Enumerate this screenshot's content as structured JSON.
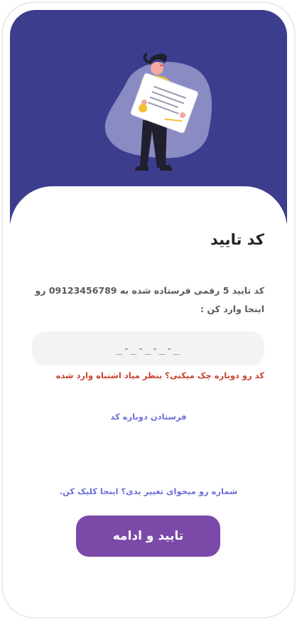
{
  "screen": {
    "title": "کد تایید",
    "description": "کد تایید 5 رقمی فرستاده شده به 09123456789 رو اینجا وارد کن :"
  },
  "code_input": {
    "placeholder": "_-_-_-_-_",
    "value": ""
  },
  "error_message": "کد رو دوباره چک میکنی؟ بنظر میاد اشتباه وارد شده",
  "links": {
    "resend_code": "فرستادن دوباره کد",
    "change_number": "شماره رو میخوای تغییر بدی؟ اینجا کلیک کن."
  },
  "buttons": {
    "submit_label": "تایید و ادامه"
  },
  "colors": {
    "hero_background": "#3d3d8e",
    "primary_button": "#7b4aa8",
    "link": "#6b6fd6",
    "error": "#c9402a"
  },
  "illustration": {
    "icon": "woman-holding-document-illustration"
  }
}
